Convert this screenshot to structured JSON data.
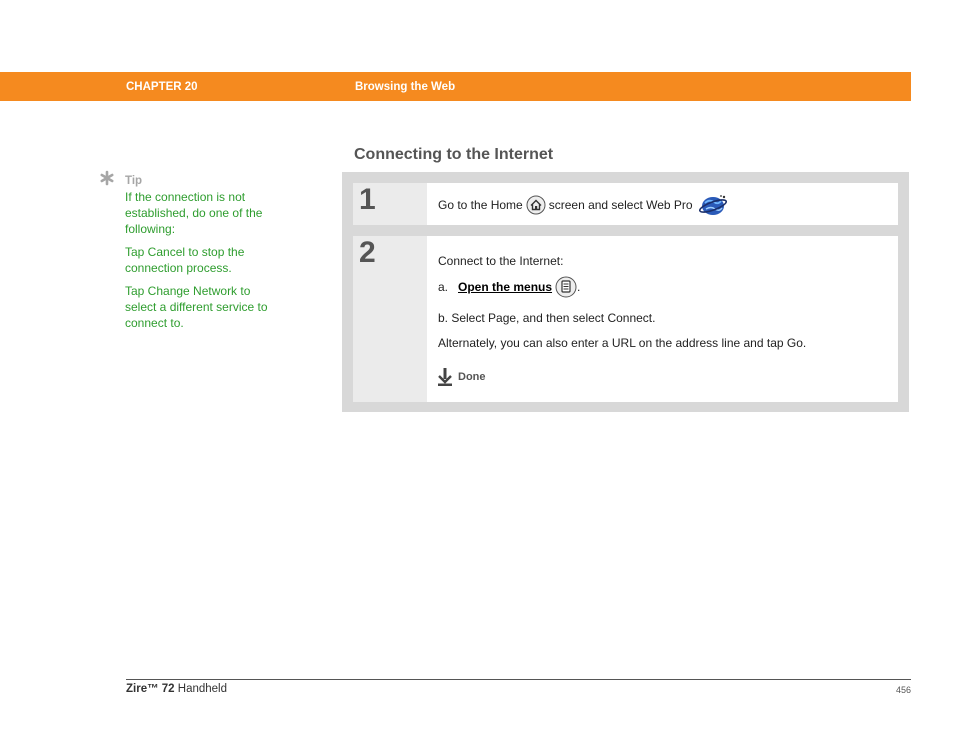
{
  "header": {
    "chapter": "CHAPTER 20",
    "section": "Browsing the Web",
    "bar_color": "#f58a1f"
  },
  "sidebar_tip": {
    "icon": "asterisk-icon",
    "label": "Tip",
    "paragraphs": [
      "If the connection is not established, do one of the following:",
      "Tap Cancel to stop the connection process.",
      "Tap Change Network to select a different service to connect to."
    ],
    "text_color": "#2e9d2e"
  },
  "main": {
    "heading": "Connecting to the Internet",
    "steps": [
      {
        "number": "1",
        "text_before_home": "Go to the Home",
        "home_icon": "home-icon",
        "text_after_home": "screen and select Web Pro",
        "webpro_icon": "web-pro-globe-icon"
      },
      {
        "number": "2",
        "intro": "Connect to the Internet:",
        "item_a_prefix": "a.",
        "item_a_link": "Open the menus",
        "menu_icon": "menu-icon",
        "item_a_suffix": ".",
        "item_b": "b.  Select Page, and then select Connect.",
        "alternate": "Alternately, you can also enter a URL on the address line and tap Go.",
        "done_icon": "done-arrow-icon",
        "done_label": "Done"
      }
    ]
  },
  "footer": {
    "product_bold": "Zire™ 72",
    "product_rest": " Handheld",
    "page_number": "456"
  }
}
